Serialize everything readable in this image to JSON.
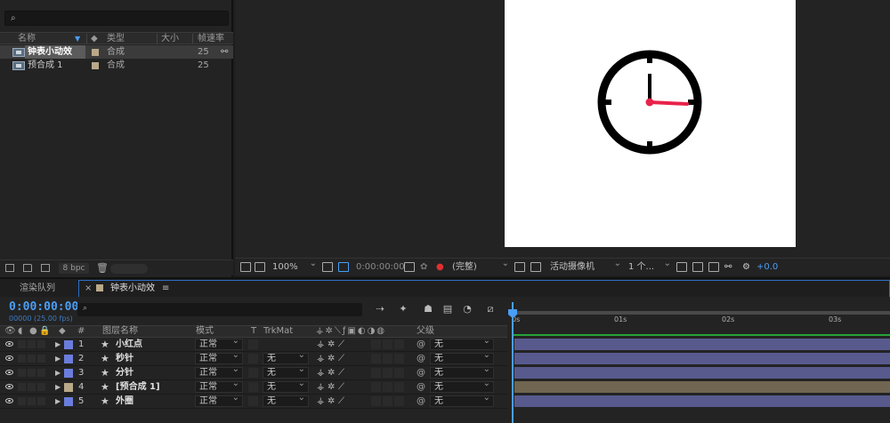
{
  "project": {
    "search_glyph": "⌕",
    "columns": {
      "name": "名称",
      "type": "类型",
      "size": "大小",
      "fps": "帧速率"
    },
    "items": [
      {
        "name": "钟表小动效",
        "type": "合成",
        "fps": "25"
      },
      {
        "name": "预合成 1",
        "type": "合成",
        "fps": "25"
      }
    ],
    "bpc": "8 bpc"
  },
  "viewer": {
    "zoom": "100%",
    "timecode": "0:00:00:00",
    "resolution": "(完整)",
    "camera": "活动摄像机",
    "views": "1 个...",
    "exposure": "+0.0"
  },
  "timeline": {
    "tabs": {
      "render_queue": "渲染队列",
      "comp": "钟表小动效",
      "close": "×",
      "menu": "≡"
    },
    "timecode": "0:00:00:00",
    "framecode": "00000 (25.00 fps)",
    "search_glyph": "⌕",
    "columns": {
      "hash": "#",
      "layer_name": "图层名称",
      "mode": "模式",
      "t": "T",
      "trkmat": "TrkMat",
      "parent": "父级"
    },
    "ruler": [
      "0s",
      "01s",
      "02s",
      "03s"
    ],
    "layers": [
      {
        "index": "1",
        "name": "小红点",
        "mode": "正常",
        "trkmat": "",
        "parent": "无",
        "label_color": "#6b7ddc",
        "bar_color": "#585a8e"
      },
      {
        "index": "2",
        "name": "秒针",
        "mode": "正常",
        "trkmat": "无",
        "parent": "无",
        "label_color": "#6b7ddc",
        "bar_color": "#585a8e"
      },
      {
        "index": "3",
        "name": "分针",
        "mode": "正常",
        "trkmat": "无",
        "parent": "无",
        "label_color": "#6b7ddc",
        "bar_color": "#585a8e"
      },
      {
        "index": "4",
        "name": "[预合成 1]",
        "mode": "正常",
        "trkmat": "无",
        "parent": "无",
        "label_color": "#b9a98a",
        "bar_color": "#706651"
      },
      {
        "index": "5",
        "name": "外圈",
        "mode": "正常",
        "trkmat": "无",
        "parent": "无",
        "label_color": "#6b7ddc",
        "bar_color": "#585a8e"
      }
    ]
  },
  "colors": {
    "accent": "#4a9ef5",
    "clock_hand_red": "#e8224a",
    "work_area": "#27a33a"
  }
}
